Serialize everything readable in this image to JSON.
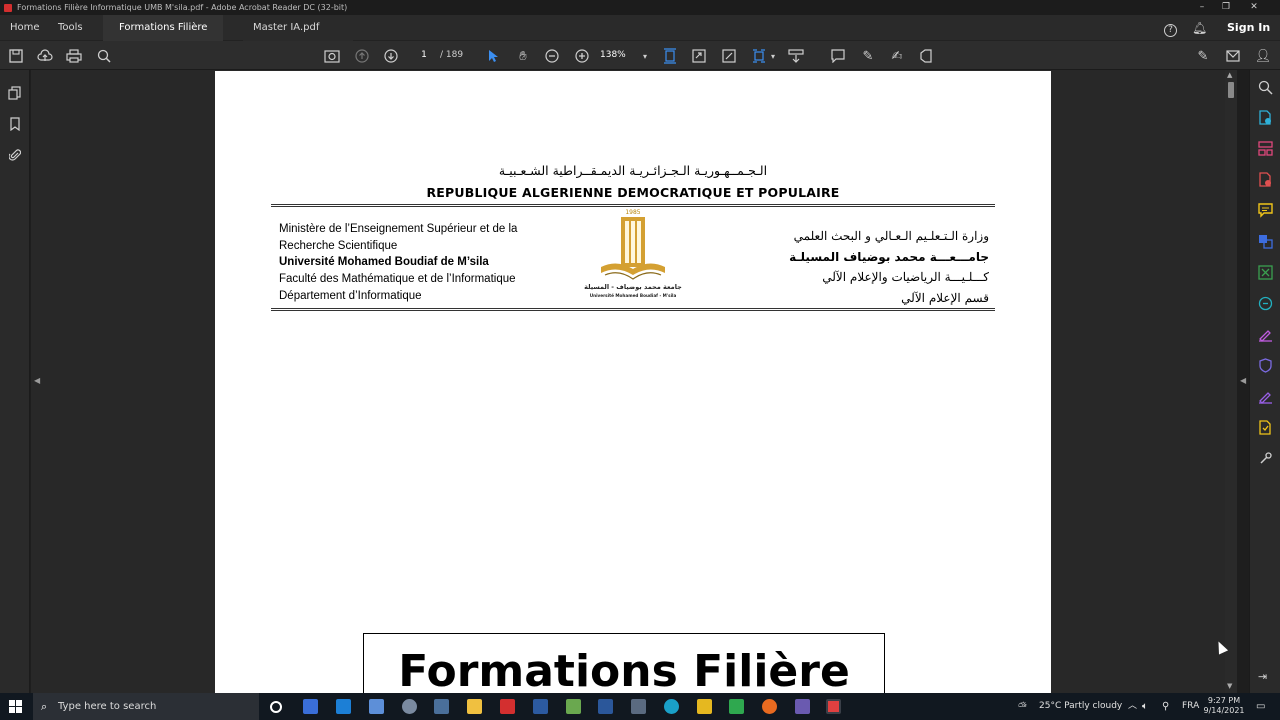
{
  "window": {
    "title": "Formations Filière Informatique UMB M'sila.pdf - Adobe Acrobat Reader DC (32-bit)"
  },
  "tabs": {
    "home": "Home",
    "tools": "Tools",
    "doc1": "Formations Filière I...",
    "doc2": "Master IA.pdf",
    "close": "×",
    "sign_in": "Sign In"
  },
  "toolbar": {
    "page_current": "1",
    "page_total": "/ 189",
    "zoom": "138%"
  },
  "document": {
    "arabic_republic": "الـجـمــهـوريـة الـجـزائـريـة الديمـقــراطية الشـعـبيـة",
    "french_republic": "REPUBLIQUE ALGERIENNE DEMOCRATIQUE  ET  POPULAIRE",
    "left": {
      "line1": "Ministère de l’Enseignement Supérieur et de la",
      "line2": "Recherche Scientifique",
      "line3": "Université  Mohamed Boudiaf  de M’sila",
      "line4": "Faculté des Mathématique et de l’Informatique",
      "line5": "Département d’Informatique"
    },
    "right": {
      "line1": "وزارة الـتـعلـيم الـعـالي و البحث العلمي",
      "line2": "جامـــعـــة محمد بوضياف المسيلـة",
      "line3": "كـــلـيـــة الرياضيات والإعلام الآلي",
      "line4": "قسم الإعلام الآلي"
    },
    "logo": {
      "year": "1985",
      "arabic": "جامعة محمد بوضياف - المسيلة",
      "latin": "Université Mohamed Boudiaf - M'sila"
    },
    "heading": "Formations Filière"
  },
  "taskbar": {
    "search_placeholder": "Type here to search",
    "weather": "25°C  Partly cloudy",
    "language": "FRA",
    "time": "9:27 PM",
    "date": "9/14/2021"
  },
  "colors": {
    "accent": "#3b8ef0",
    "acrobat_red": "#d32f2f",
    "logo_gold": "#d4a032"
  }
}
